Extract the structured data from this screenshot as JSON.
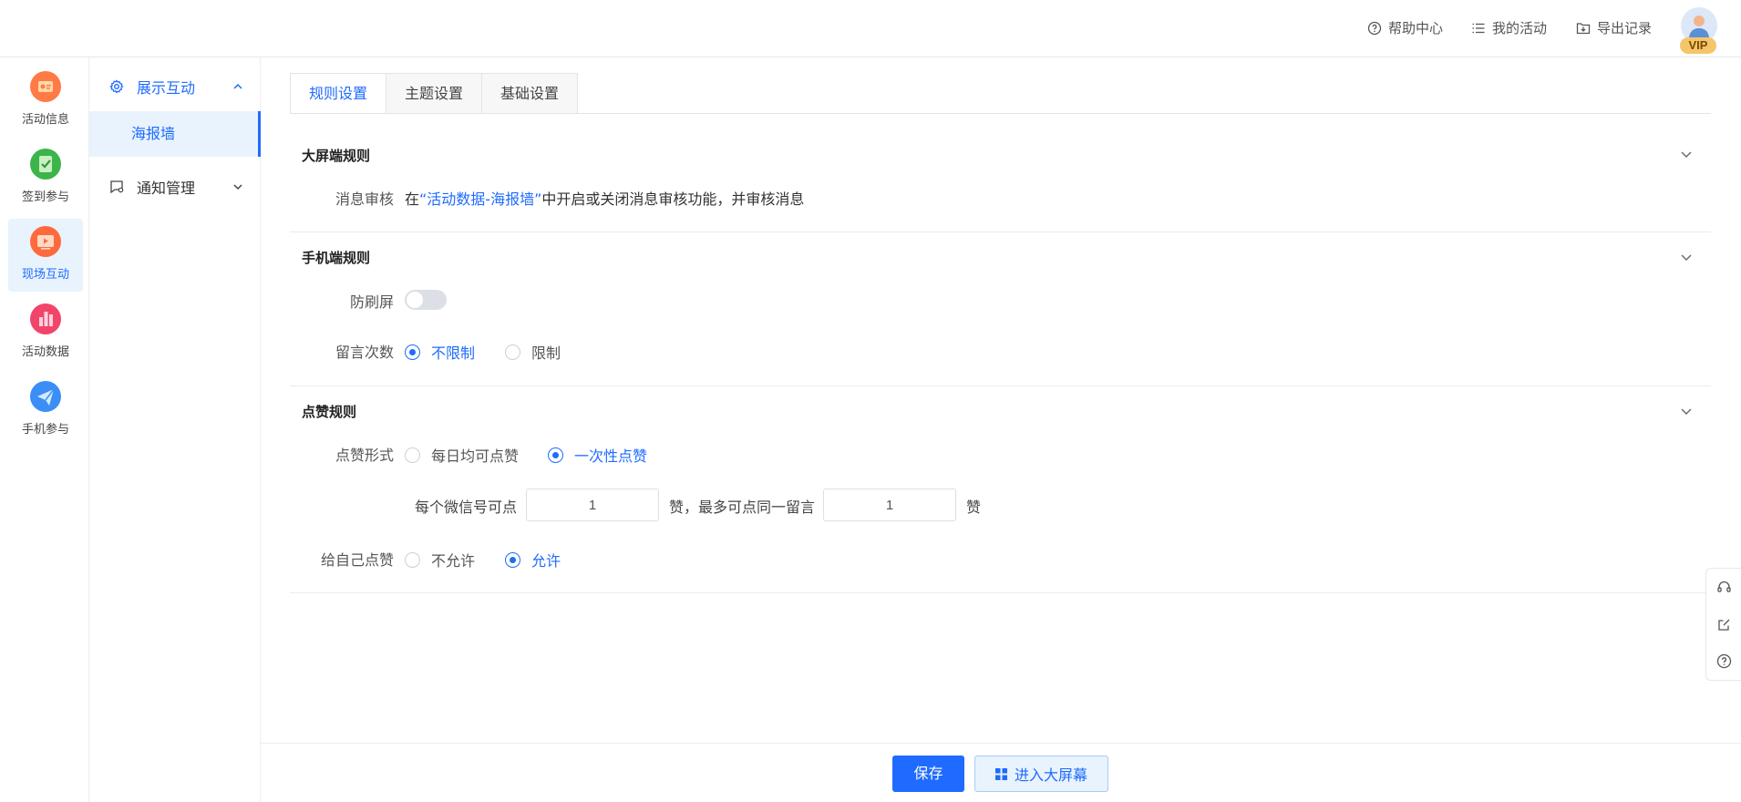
{
  "topbar": {
    "help": "帮助中心",
    "activities": "我的活动",
    "export": "导出记录",
    "vip": "VIP"
  },
  "rail": [
    {
      "label": "活动信息",
      "icon": "activity-info-icon",
      "color": "#ff7a45"
    },
    {
      "label": "签到参与",
      "icon": "checkin-icon",
      "color": "#3bb54a"
    },
    {
      "label": "现场互动",
      "icon": "live-interaction-icon",
      "color": "#ff6a3d",
      "active": true
    },
    {
      "label": "活动数据",
      "icon": "data-chart-icon",
      "color": "#f2456a"
    },
    {
      "label": "手机参与",
      "icon": "paper-plane-icon",
      "color": "#3a8ef6"
    }
  ],
  "subnav": {
    "group1": "展示互动",
    "item1": "海报墙",
    "group2": "通知管理"
  },
  "tabs": [
    "规则设置",
    "主题设置",
    "基础设置"
  ],
  "sections": {
    "big_screen": {
      "title": "大屏端规则",
      "review_label": "消息审核",
      "review_pre": "在",
      "review_link": "“活动数据-海报墙”",
      "review_post": "中开启或关闭消息审核功能，并审核消息"
    },
    "mobile": {
      "title": "手机端规则",
      "anti_spam_label": "防刷屏",
      "anti_spam_on": false,
      "count_label": "留言次数",
      "count_options": [
        "不限制",
        "限制"
      ],
      "count_selected": "不限制"
    },
    "like": {
      "title": "点赞规则",
      "form_label": "点赞形式",
      "form_options": [
        "每日均可点赞",
        "一次性点赞"
      ],
      "form_selected": "一次性点赞",
      "per_wechat_pre": "每个微信号可点",
      "per_wechat_value": "1",
      "per_wechat_mid": "赞，最多可点同一留言",
      "same_msg_value": "1",
      "same_msg_post": "赞",
      "self_label": "给自己点赞",
      "self_options": [
        "不允许",
        "允许"
      ],
      "self_selected": "允许"
    }
  },
  "footer": {
    "save": "保存",
    "enter_screen": "进入大屏幕"
  },
  "colors": {
    "primary": "#1f6bff",
    "active_bg": "#e8f3fd"
  }
}
